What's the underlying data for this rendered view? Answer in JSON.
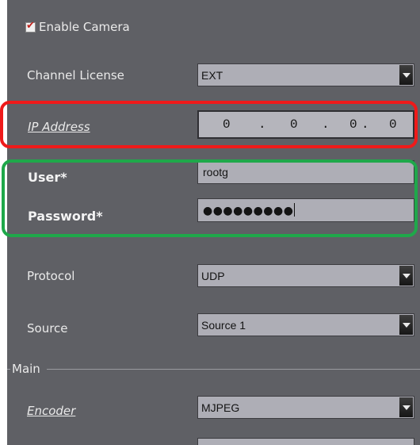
{
  "camera": {
    "enable_label": "Enable Camera",
    "enabled": true
  },
  "channel_license": {
    "label": "Channel License",
    "value": "EXT"
  },
  "ip_address": {
    "label": "IP Address",
    "octets": [
      "0",
      "0",
      "0",
      "0"
    ],
    "separator": "."
  },
  "user": {
    "label": "User*",
    "value": "rootg"
  },
  "password": {
    "label": "Password*",
    "masked_value": "●●●●●●●●●"
  },
  "protocol": {
    "label": "Protocol",
    "value": "UDP"
  },
  "source": {
    "label": "Source",
    "value": "Source 1"
  },
  "main_group": {
    "title": "Main"
  },
  "encoder": {
    "label": "Encoder",
    "value": "MJPEG"
  },
  "highlight_colors": {
    "ip_box": "#ef1a1a",
    "credentials_box": "#1fa84a"
  }
}
